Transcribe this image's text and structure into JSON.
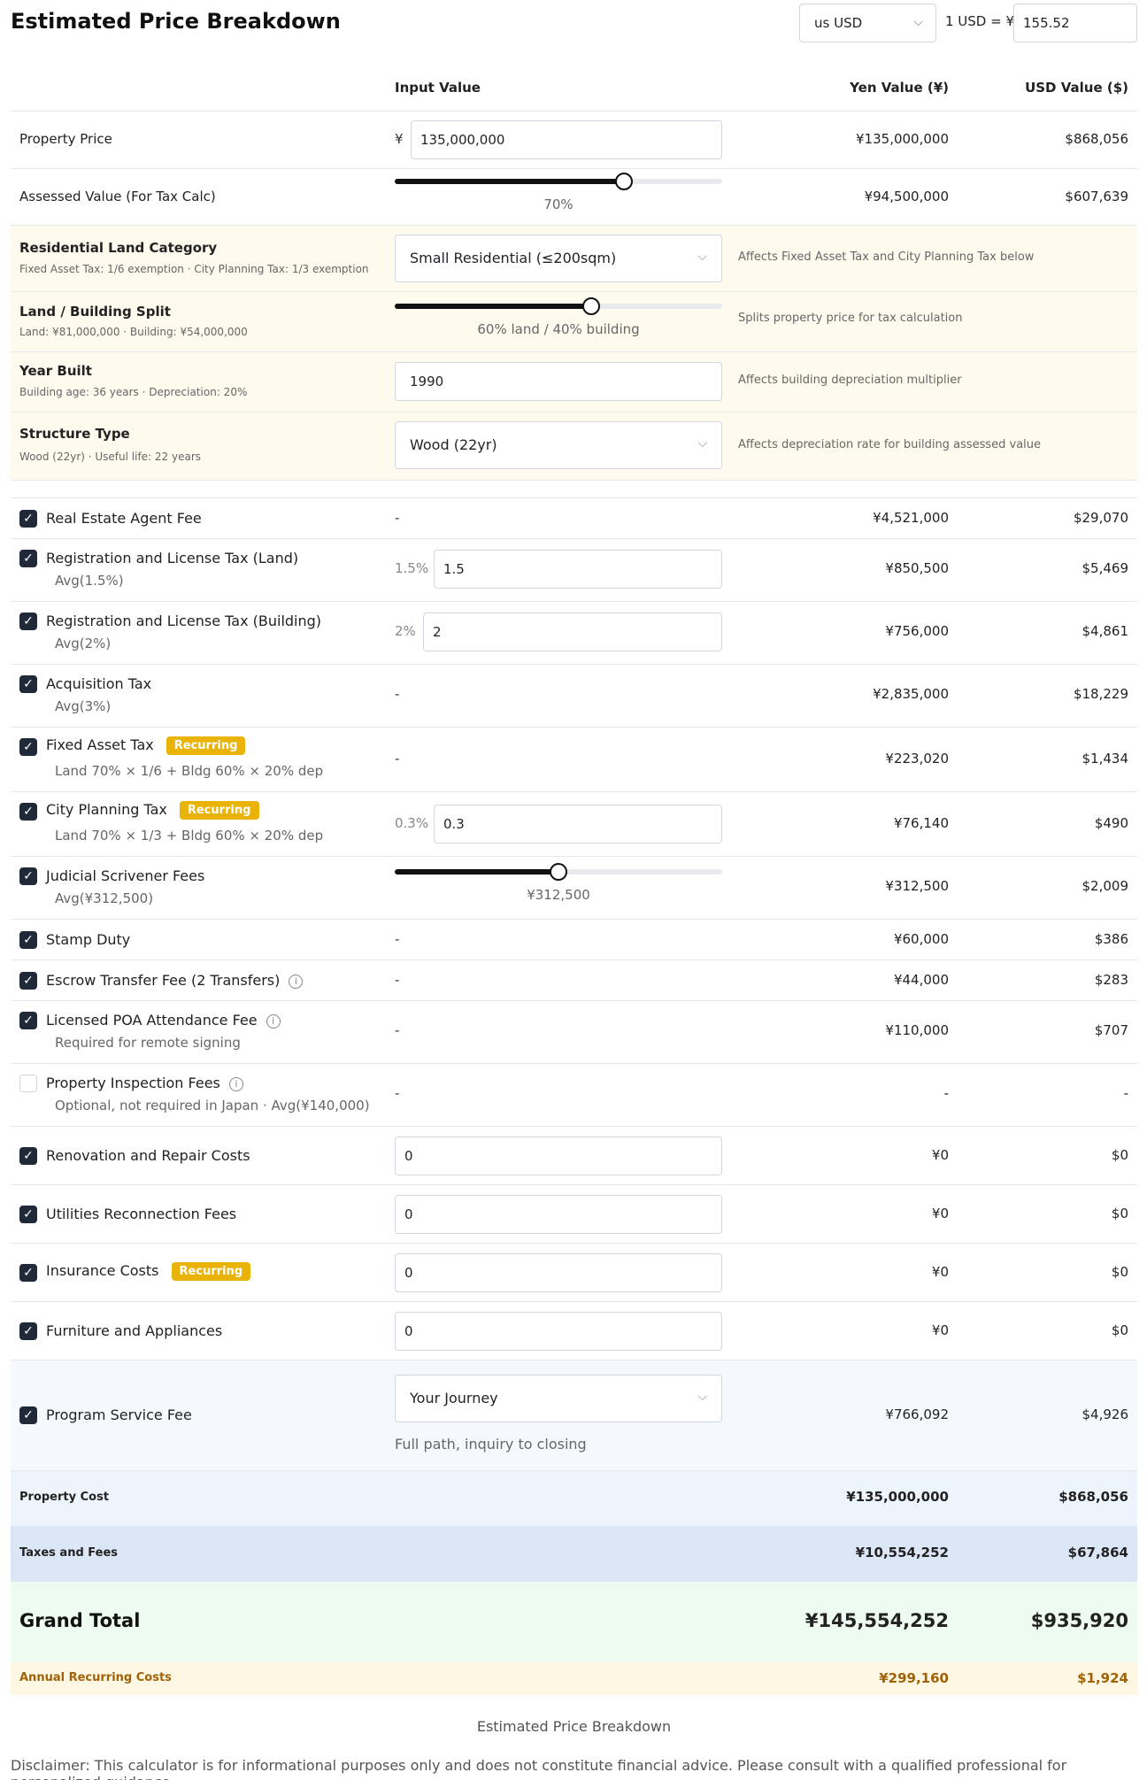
{
  "header": {
    "title": "Estimated Price Breakdown",
    "currency": "us  USD",
    "rate_label": "1 USD = ¥",
    "rate_value": "155.52"
  },
  "columns": {
    "input": "Input Value",
    "yen": "Yen Value (¥)",
    "usd": "USD Value ($)"
  },
  "property_price": {
    "label": "Property Price",
    "prefix": "¥",
    "value": "135,000,000",
    "yen": "¥135,000,000",
    "usd": "$868,056"
  },
  "assessed": {
    "label": "Assessed Value (For Tax Calc)",
    "slider_label": "70%",
    "level": 0.7,
    "yen": "¥94,500,000",
    "usd": "$607,639"
  },
  "land_category": {
    "label": "Residential Land Category",
    "sub": "Fixed Asset Tax: 1/6 exemption · City Planning Tax: 1/3 exemption",
    "value": "Small Residential (≤200sqm)",
    "effect": "Affects Fixed Asset Tax and City Planning Tax below"
  },
  "split": {
    "label": "Land / Building Split",
    "sub": "Land: ¥81,000,000 · Building: ¥54,000,000",
    "slider_label": "60% land / 40% building",
    "level": 0.6,
    "effect": "Splits property price for tax calculation"
  },
  "year_built": {
    "label": "Year Built",
    "sub": "Building age: 36 years · Depreciation: 20%",
    "value": "1990",
    "effect": "Affects building depreciation multiplier"
  },
  "structure": {
    "label": "Structure Type",
    "sub": "Wood (22yr) · Useful life: 22 years",
    "value": "Wood (22yr)",
    "effect": "Affects depreciation rate for building assessed value"
  },
  "fees": {
    "agent": {
      "label": "Real Estate Agent Fee",
      "input": "-",
      "yen": "¥4,521,000",
      "usd": "$29,070"
    },
    "reg_land": {
      "label": "Registration and License Tax (Land)",
      "sub": "Avg(1.5%)",
      "prefix": "1.5%",
      "value": "1.5",
      "yen": "¥850,500",
      "usd": "$5,469"
    },
    "reg_bldg": {
      "label": "Registration and License Tax (Building)",
      "sub": "Avg(2%)",
      "prefix": "2%",
      "value": "2",
      "yen": "¥756,000",
      "usd": "$4,861"
    },
    "acq": {
      "label": "Acquisition Tax",
      "sub": "Avg(3%)",
      "input": "-",
      "yen": "¥2,835,000",
      "usd": "$18,229"
    },
    "fixed": {
      "label": "Fixed Asset Tax",
      "badge": "Recurring",
      "sub": "Land 70% × 1/6 + Bldg 60% × 20% dep",
      "input": "-",
      "yen": "¥223,020",
      "usd": "$1,434"
    },
    "city": {
      "label": "City Planning Tax",
      "badge": "Recurring",
      "sub": "Land 70% × 1/3 + Bldg 60% × 20% dep",
      "prefix": "0.3%",
      "value": "0.3",
      "yen": "¥76,140",
      "usd": "$490"
    },
    "scrivener": {
      "label": "Judicial Scrivener Fees",
      "sub": "Avg(¥312,500)",
      "slider_label": "¥312,500",
      "level": 0.5,
      "yen": "¥312,500",
      "usd": "$2,009"
    },
    "stamp": {
      "label": "Stamp Duty",
      "input": "-",
      "yen": "¥60,000",
      "usd": "$386"
    },
    "escrow": {
      "label": "Escrow Transfer Fee (2 Transfers)",
      "input": "-",
      "yen": "¥44,000",
      "usd": "$283"
    },
    "poa": {
      "label": "Licensed POA Attendance Fee",
      "sub": "Required for remote signing",
      "input": "-",
      "yen": "¥110,000",
      "usd": "$707"
    },
    "inspection": {
      "label": "Property Inspection Fees",
      "sub": "Optional, not required in Japan · Avg(¥140,000)",
      "input": "-",
      "yen": "-",
      "usd": "-"
    },
    "renovation": {
      "label": "Renovation and Repair Costs",
      "value": "0",
      "yen": "¥0",
      "usd": "$0"
    },
    "utilities": {
      "label": "Utilities Reconnection Fees",
      "value": "0",
      "yen": "¥0",
      "usd": "$0"
    },
    "insurance": {
      "label": "Insurance Costs",
      "badge": "Recurring",
      "value": "0",
      "yen": "¥0",
      "usd": "$0"
    },
    "furniture": {
      "label": "Furniture and Appliances",
      "value": "0",
      "yen": "¥0",
      "usd": "$0"
    },
    "program": {
      "label": "Program Service Fee",
      "value": "Your Journey",
      "sub": "Full path, inquiry to closing",
      "yen": "¥766,092",
      "usd": "$4,926"
    }
  },
  "info_glyph": "i",
  "check_glyph": "✓",
  "chevron_glyph": "⌵",
  "summary": {
    "property": {
      "label": "Property Cost",
      "yen": "¥135,000,000",
      "usd": "$868,056"
    },
    "taxes": {
      "label": "Taxes and Fees",
      "yen": "¥10,554,252",
      "usd": "$67,864"
    },
    "grand": {
      "label": "Grand Total",
      "yen": "¥145,554,252",
      "usd": "$935,920"
    },
    "annual": {
      "label": "Annual Recurring Costs",
      "yen": "¥299,160",
      "usd": "$1,924"
    }
  },
  "footer": {
    "caption": "Estimated Price Breakdown",
    "disclaimer": "Disclaimer: This calculator is for informational purposes only and does not constitute financial advice. Please consult with a qualified professional for personalized guidance."
  },
  "colors": {
    "accent": "#eab308",
    "dark": "#1f2937",
    "cream": "#fffaee",
    "blue_light": "#eef4fc",
    "blue": "#dbe7f7",
    "green": "#eefbf1",
    "annual": "#fdf7e3",
    "annual_text": "#a16207"
  }
}
